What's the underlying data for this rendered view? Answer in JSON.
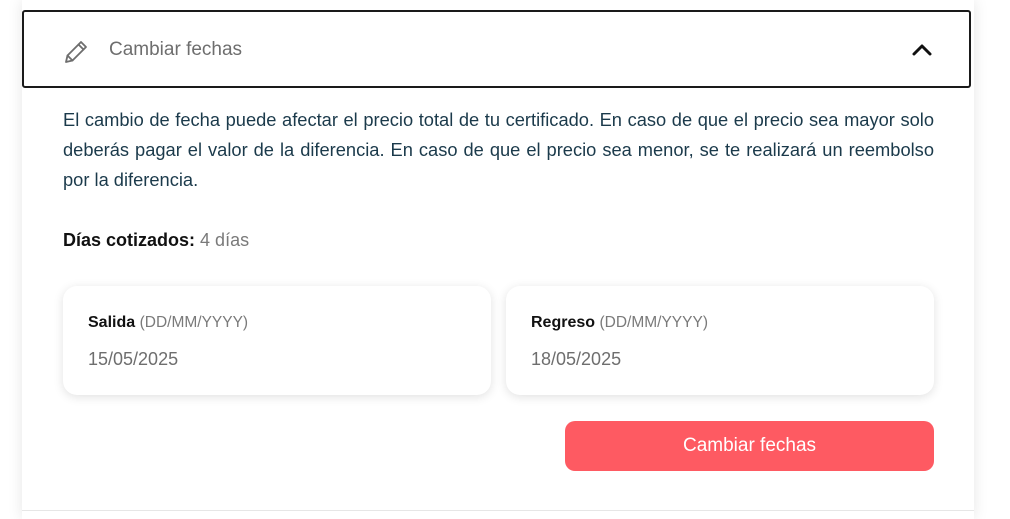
{
  "accordion": {
    "title": "Cambiar fechas",
    "icon": "pencil-icon",
    "toggle_icon": "chevron-up-icon",
    "expanded": true
  },
  "description": "El cambio de fecha puede afectar el precio total de tu certificado. En caso de que el precio sea mayor solo deberás pagar el valor de la diferencia. En caso de que el precio sea menor, se te realizará un reembolso por la diferencia.",
  "days": {
    "label": "Días cotizados:",
    "value": "4 días"
  },
  "departure": {
    "label": "Salida",
    "format": "(DD/MM/YYYY)",
    "value": "15/05/2025"
  },
  "return": {
    "label": "Regreso",
    "format": "(DD/MM/YYYY)",
    "value": "18/05/2025"
  },
  "submit": {
    "label": "Cambiar fechas"
  },
  "colors": {
    "accent": "#fe5a62",
    "text_primary": "#1b3a4b",
    "muted": "#6e6e6e"
  }
}
